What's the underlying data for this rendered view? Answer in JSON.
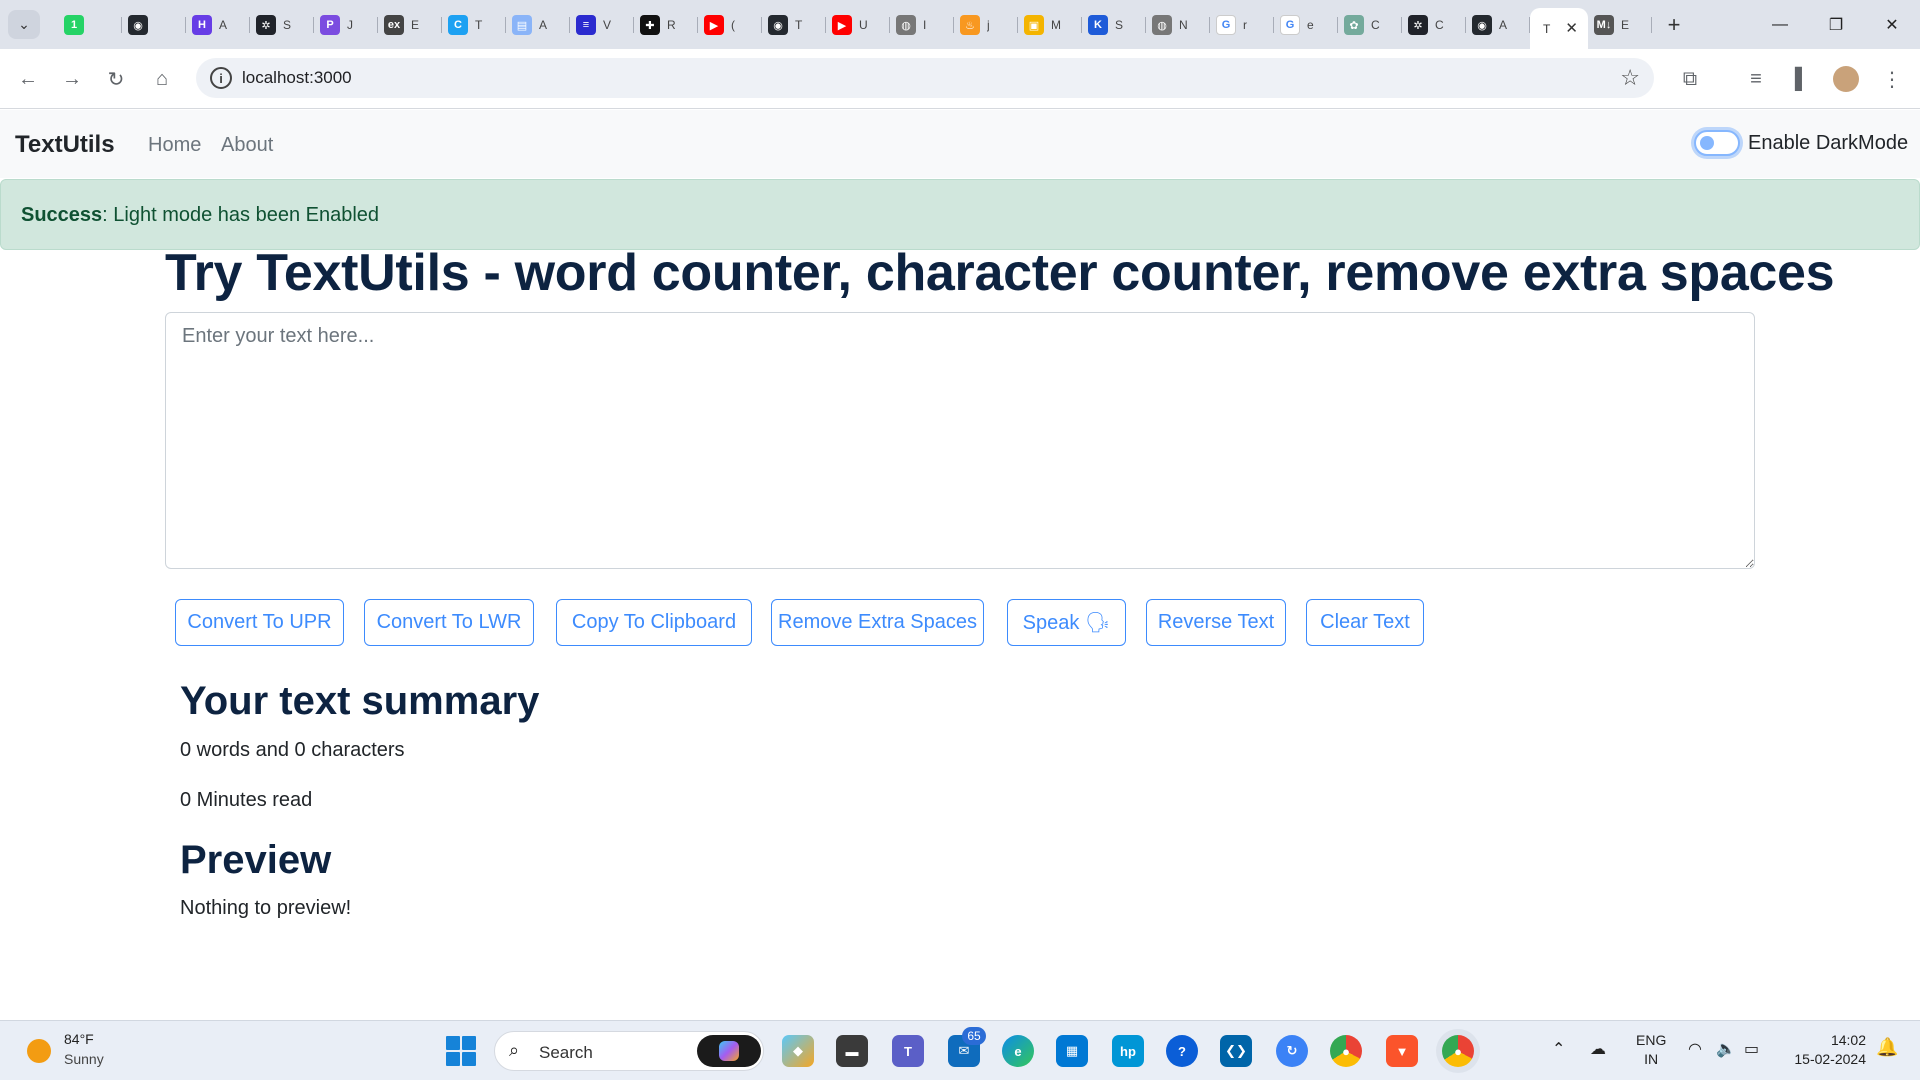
{
  "browser": {
    "tabs": [
      {
        "label": "",
        "icon": "whatsapp-icon",
        "color": "#25d366",
        "glyph": "1"
      },
      {
        "label": "",
        "icon": "github-icon",
        "color": "#24292f",
        "glyph": "◉"
      },
      {
        "label": "A",
        "icon": "hostinger-icon",
        "color": "#673de6",
        "glyph": "H"
      },
      {
        "label": "S",
        "icon": "react-icon",
        "color": "#20232a",
        "glyph": "✲"
      },
      {
        "label": "J",
        "icon": "paytm-icon",
        "color": "#7b4ce0",
        "glyph": "P"
      },
      {
        "label": "E",
        "icon": "express-icon",
        "color": "#444444",
        "glyph": "ex"
      },
      {
        "label": "T",
        "icon": "c-icon",
        "color": "#1da1f2",
        "glyph": "C"
      },
      {
        "label": "A",
        "icon": "docs-icon",
        "color": "#8ab4f8",
        "glyph": "▤"
      },
      {
        "label": "V",
        "icon": "dsa-icon",
        "color": "#2b2bcf",
        "glyph": "≡"
      },
      {
        "label": "R",
        "icon": "puzzle-icon",
        "color": "#111111",
        "glyph": "✚"
      },
      {
        "label": "(",
        "icon": "youtube-icon",
        "color": "#ff0000",
        "glyph": "▶"
      },
      {
        "label": "T",
        "icon": "github-icon",
        "color": "#24292f",
        "glyph": "◉"
      },
      {
        "label": "U",
        "icon": "youtube-icon",
        "color": "#ff0000",
        "glyph": "▶"
      },
      {
        "label": "I",
        "icon": "globe-icon",
        "color": "#777777",
        "glyph": "◍"
      },
      {
        "label": "j",
        "icon": "java-icon",
        "color": "#f89820",
        "glyph": "♨"
      },
      {
        "label": "M",
        "icon": "maps-icon",
        "color": "#f4b400",
        "glyph": "▣"
      },
      {
        "label": "S",
        "icon": "k-icon",
        "color": "#1e5bd8",
        "glyph": "K"
      },
      {
        "label": "N",
        "icon": "globe-icon",
        "color": "#777777",
        "glyph": "◍"
      },
      {
        "label": "r",
        "icon": "google-icon",
        "color": "#ffffff",
        "glyph": "G"
      },
      {
        "label": "e",
        "icon": "google-icon",
        "color": "#ffffff",
        "glyph": "G"
      },
      {
        "label": "C",
        "icon": "chatgpt-icon",
        "color": "#74aa9c",
        "glyph": "✿"
      },
      {
        "label": "C",
        "icon": "react-icon",
        "color": "#20232a",
        "glyph": "✲"
      },
      {
        "label": "A",
        "icon": "github-icon",
        "color": "#24292f",
        "glyph": "◉"
      },
      {
        "label": "T",
        "icon": "",
        "color": "",
        "glyph": "",
        "active": true
      },
      {
        "label": "E",
        "icon": "markdown-icon",
        "color": "#555555",
        "glyph": "M↓"
      }
    ],
    "url": "localhost:3000"
  },
  "app": {
    "brand": "TextUtils",
    "nav": {
      "home": "Home",
      "about": "About"
    },
    "dark_mode_label": "Enable DarkMode",
    "alert": {
      "type": "Success",
      "message": ": Light mode has been Enabled"
    },
    "heading": "Try TextUtils - word counter, character counter, remove extra spaces",
    "textarea_placeholder": "Enter your text here...",
    "buttons": {
      "upper": "Convert To UPR",
      "lower": "Convert To LWR",
      "copy": "Copy To Clipboard",
      "spaces": "Remove Extra Spaces",
      "speak": "Speak 🗣",
      "reverse": "Reverse Text",
      "clear": "Clear Text"
    },
    "summary": {
      "title": "Your text summary",
      "counts": "0 words and 0 characters",
      "read_time": "0 Minutes read"
    },
    "preview": {
      "title": "Preview",
      "text": "Nothing to preview!"
    }
  },
  "taskbar": {
    "weather": {
      "temp": "84°F",
      "condition": "Sunny"
    },
    "search_label": "Search",
    "mail_badge": "65",
    "language": {
      "line1": "ENG",
      "line2": "IN"
    },
    "time": "14:02",
    "date": "15-02-2024"
  },
  "colors": {
    "accent": "#3d8bfd",
    "alert_bg": "#d1e7dd",
    "alert_text": "#0f5132",
    "heading": "#0d2341"
  }
}
